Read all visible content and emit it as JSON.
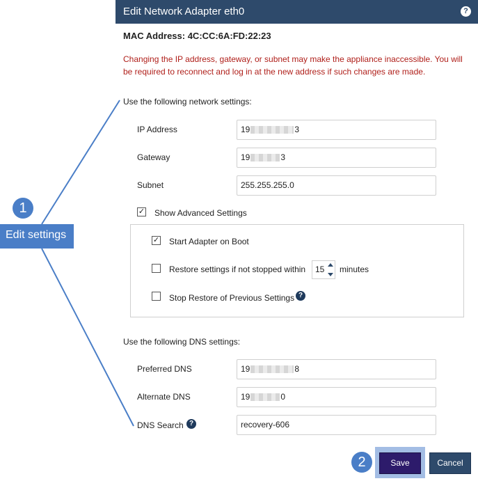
{
  "dialog": {
    "title": "Edit Network Adapter eth0",
    "help_icon": "question-icon",
    "mac_address": "MAC Address: 4C:CC:6A:FD:22:23",
    "warning": "Changing the IP address, gateway, or subnet may make the appliance inaccessible. You will be required to reconnect and log in at the new address if such changes are made."
  },
  "network": {
    "section_title": "Use the following network settings:",
    "ip_address": {
      "label": "IP Address",
      "value_prefix": "19",
      "value_suffix": "3"
    },
    "gateway": {
      "label": "Gateway",
      "value_prefix": "19",
      "value_suffix": "3"
    },
    "subnet": {
      "label": "Subnet",
      "value": "255.255.255.0"
    },
    "show_advanced": {
      "label": "Show Advanced Settings",
      "checked": true
    }
  },
  "advanced": {
    "start_on_boot": {
      "label": "Start Adapter on Boot",
      "checked": true
    },
    "restore_settings": {
      "label": "Restore settings if not stopped within",
      "checked": false,
      "minutes": "15",
      "unit": "minutes"
    },
    "stop_restore": {
      "label": "Stop Restore of Previous Settings",
      "checked": false
    }
  },
  "dns": {
    "section_title": "Use the following DNS settings:",
    "preferred": {
      "label": "Preferred DNS",
      "value_prefix": "19",
      "value_suffix": "8"
    },
    "alternate": {
      "label": "Alternate DNS",
      "value_prefix": "19",
      "value_suffix": "0"
    },
    "search": {
      "label": "DNS Search",
      "value": "recovery-606"
    }
  },
  "buttons": {
    "save": "Save",
    "cancel": "Cancel"
  },
  "callouts": {
    "step1_number": "1",
    "step1_label": "Edit settings",
    "step2_number": "2",
    "color": "#4a7ec7"
  },
  "colors": {
    "header": "#2e4a6b",
    "warning": "#b0201b",
    "save": "#2d1b6b"
  }
}
